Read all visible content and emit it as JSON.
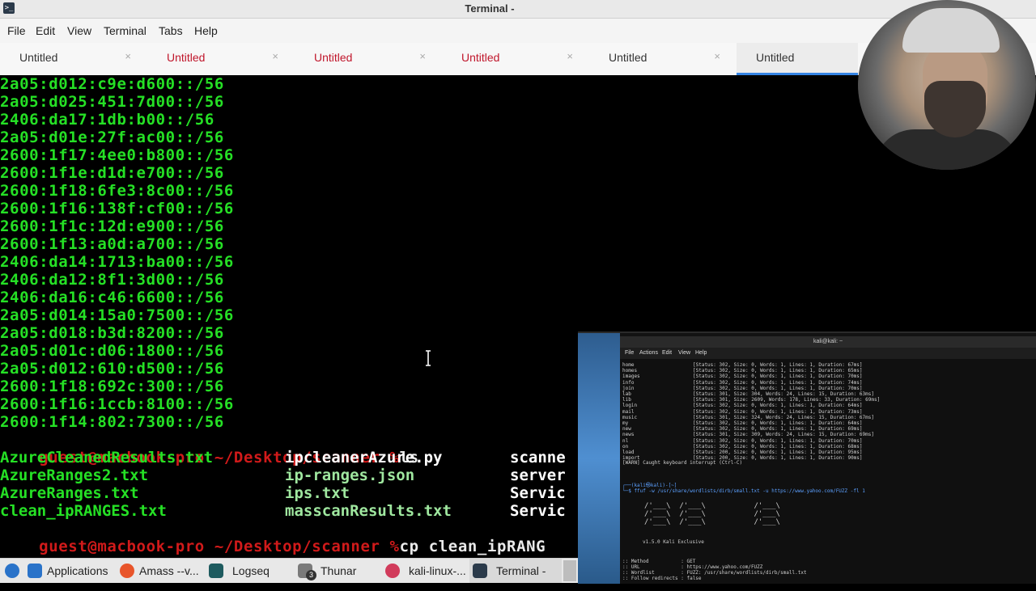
{
  "window": {
    "title": "Terminal -"
  },
  "menu": [
    "File",
    "Edit",
    "View",
    "Terminal",
    "Tabs",
    "Help"
  ],
  "tabs": [
    {
      "label": "Untitled",
      "color": "#333333"
    },
    {
      "label": "Untitled",
      "color": "#c0162b"
    },
    {
      "label": "Untitled",
      "color": "#c0162b"
    },
    {
      "label": "Untitled",
      "color": "#c0162b"
    },
    {
      "label": "Untitled",
      "color": "#333333"
    },
    {
      "label": "Untitled",
      "color": "#333333",
      "active": true
    }
  ],
  "tab_close": "×",
  "terminal": {
    "lines": [
      "2a05:d012:c9e:d600::/56",
      "2a05:d025:451:7d00::/56",
      "2406:da17:1db:b00::/56",
      "2a05:d01e:27f:ac00::/56",
      "2600:1f17:4ee0:b800::/56",
      "2600:1f1e:d1d:e700::/56",
      "2600:1f18:6fe3:8c00::/56",
      "2600:1f16:138f:cf00::/56",
      "2600:1f1c:12d:e900::/56",
      "2600:1f13:a0d:a700::/56",
      "2406:da14:1713:ba00::/56",
      "2406:da12:8f1:3d00::/56",
      "2406:da16:c46:6600::/56",
      "2a05:d014:15a0:7500::/56",
      "2a05:d018:b3d:8200::/56",
      "2a05:d01c:d06:1800::/56",
      "2a05:d012:610:d500::/56",
      "2600:1f18:692c:300::/56",
      "2600:1f16:1ccb:8100::/56",
      "2600:1f14:802:7300::/56"
    ],
    "prompt": "guest@macbook-pro ~/Desktop/scanner %",
    "cmd1": "ls",
    "ls_rows": [
      [
        "AzureCleanedResults.txt",
        "ipcleanerAzure.py",
        "scanne"
      ],
      [
        "AzureRanges2.txt",
        "ip-ranges.json",
        "server"
      ],
      [
        "AzureRanges.txt",
        "ips.txt",
        "Servic"
      ],
      [
        "clean_ipRANGES.txt",
        "masscanResults.txt",
        "Servic"
      ]
    ],
    "cmd2": "cp clean_ipRANG",
    "cmd3": ""
  },
  "inner_terminal": {
    "title": "kali@kali: ~",
    "menu": [
      "File",
      "Actions",
      "Edit",
      "View",
      "Help"
    ],
    "results": [
      [
        "home",
        "[Status: 302, Size: 0, Words: 1, Lines: 1, Duration: 67ms]"
      ],
      [
        "homes",
        "[Status: 302, Size: 0, Words: 1, Lines: 1, Duration: 65ms]"
      ],
      [
        "images",
        "[Status: 302, Size: 0, Words: 1, Lines: 1, Duration: 70ms]"
      ],
      [
        "info",
        "[Status: 302, Size: 0, Words: 1, Lines: 1, Duration: 74ms]"
      ],
      [
        "join",
        "[Status: 302, Size: 0, Words: 1, Lines: 1, Duration: 70ms]"
      ],
      [
        "lab",
        "[Status: 301, Size: 304, Words: 24, Lines: 15, Duration: 63ms]"
      ],
      [
        "lib",
        "[Status: 301, Size: 2609, Words: 178, Lines: 33, Duration: 69ms]"
      ],
      [
        "login",
        "[Status: 302, Size: 0, Words: 1, Lines: 1, Duration: 64ms]"
      ],
      [
        "mail",
        "[Status: 302, Size: 0, Words: 1, Lines: 1, Duration: 73ms]"
      ],
      [
        "music",
        "[Status: 301, Size: 324, Words: 24, Lines: 15, Duration: 67ms]"
      ],
      [
        "my",
        "[Status: 302, Size: 0, Words: 1, Lines: 1, Duration: 64ms]"
      ],
      [
        "new",
        "[Status: 302, Size: 0, Words: 1, Lines: 1, Duration: 69ms]"
      ],
      [
        "news",
        "[Status: 301, Size: 309, Words: 24, Lines: 15, Duration: 69ms]"
      ],
      [
        "nl",
        "[Status: 302, Size: 0, Words: 1, Lines: 1, Duration: 70ms]"
      ],
      [
        "on",
        "[Status: 302, Size: 0, Words: 1, Lines: 1, Duration: 68ms]"
      ],
      [
        "load",
        "[Status: 200, Size: 0, Words: 1, Lines: 1, Duration: 95ms]"
      ],
      [
        "import",
        "[Status: 200, Size: 0, Words: 1, Lines: 1, Duration: 90ms]"
      ]
    ],
    "warn": "[WARN] Caught keyboard interrupt (Ctrl-C)",
    "prompt_line": "┌──(kali㉿kali)-[~]",
    "command": "└─$ ffuf -w /usr/share/wordlists/dirb/small.txt -u https://www.yahoo.com/FUZZ -fl 1",
    "banner": "/'___\\  /'___\\           /'___\\",
    "version": "v1.5.0 Kali Exclusive",
    "method": ":: Method           : GET",
    "url": ":: URL              : https://www.yahoo.com/FUZZ",
    "wordlist": ":: Wordlist         : FUZZ: /usr/share/wordlists/dirb/small.txt",
    "follow": ":: Follow redirects : false"
  },
  "taskbar": [
    {
      "label": "Applications",
      "icon": "kali-dragon-icon",
      "color": "#2a73c9"
    },
    {
      "label": "Amass --v...",
      "icon": "firefox-icon",
      "color": "#e8552b"
    },
    {
      "label": "Logseq",
      "icon": "logseq-icon",
      "color": "#1e5b5f"
    },
    {
      "label": "Thunar",
      "icon": "folder-icon",
      "color": "#7a7a7a",
      "badge": "3"
    },
    {
      "label": "kali-linux-...",
      "icon": "kali-icon",
      "color": "#d13b5b"
    },
    {
      "label": "Terminal -",
      "icon": "terminal-icon",
      "color": "#2b3a4a"
    }
  ]
}
